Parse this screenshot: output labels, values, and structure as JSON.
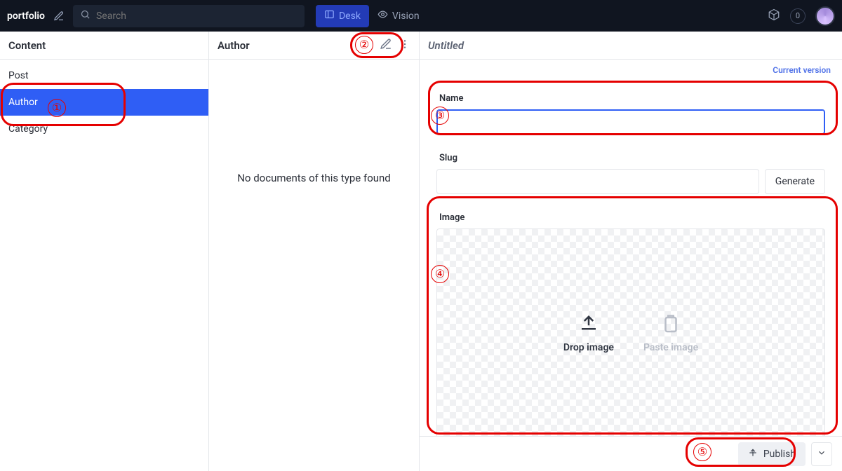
{
  "top": {
    "workspace": "portfolio",
    "search_placeholder": "Search",
    "views": [
      {
        "label": "Desk",
        "active": true
      },
      {
        "label": "Vision",
        "active": false
      }
    ],
    "notif_count": "0"
  },
  "col_content": {
    "title": "Content",
    "schemas": [
      "Post",
      "Author",
      "Category"
    ],
    "selected_index": 1
  },
  "col_docs": {
    "title": "Author",
    "empty": "No documents of this type found"
  },
  "editor": {
    "title": "Untitled",
    "version_link": "Current version",
    "fields": {
      "name_label": "Name",
      "name_value": "",
      "slug_label": "Slug",
      "slug_value": "",
      "slug_button": "Generate",
      "image_label": "Image",
      "drop_label": "Drop image",
      "paste_label": "Paste image"
    },
    "publish_label": "Publish"
  },
  "annotations": {
    "a1": "①",
    "a2": "②",
    "a3": "③",
    "a4": "④",
    "a5": "⑤"
  }
}
